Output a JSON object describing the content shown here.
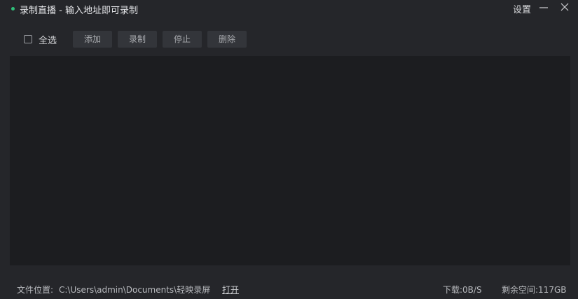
{
  "window": {
    "title": "录制直播 - 输入地址即可录制",
    "settings_label": "设置",
    "accent_color": "#2fc07a"
  },
  "toolbar": {
    "select_all_label": "全选",
    "select_all_checked": false,
    "add_label": "添加",
    "record_label": "录制",
    "stop_label": "停止",
    "delete_label": "删除"
  },
  "list": {
    "items": []
  },
  "status": {
    "path_label": "文件位置:",
    "path_value": "C:\\Users\\admin\\Documents\\轻映录屏",
    "open_label": "打开",
    "download_speed": "下载:0B/S",
    "free_space": "剩余空间:117GB"
  },
  "icons": {
    "minimize": "minimize-icon",
    "close": "close-icon",
    "status_dot": "status-dot-icon"
  }
}
